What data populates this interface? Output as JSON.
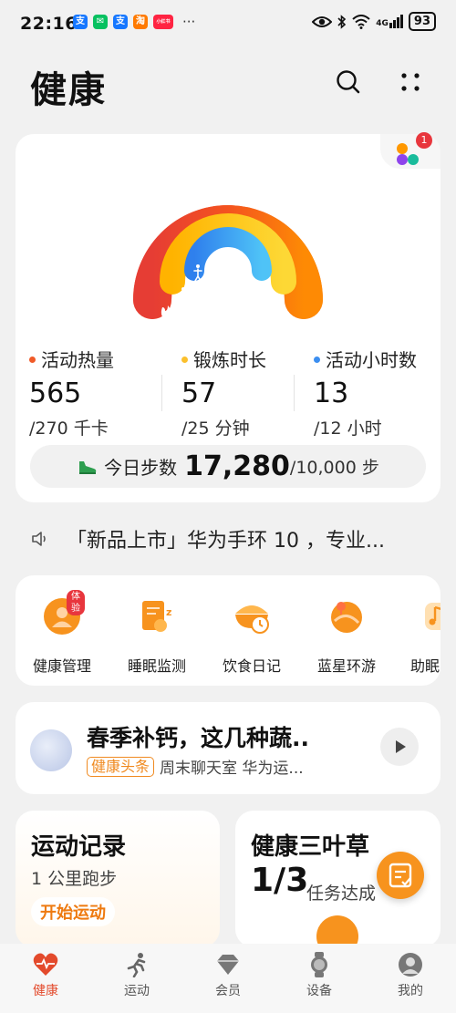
{
  "status_bar": {
    "time": "22:16",
    "app_icons": [
      {
        "name": "alipay-icon",
        "glyph": "支",
        "color": "#1677ff"
      },
      {
        "name": "wechat-icon",
        "glyph": "✉",
        "color": "#07c160"
      },
      {
        "name": "alipay-icon",
        "glyph": "支",
        "color": "#1677ff"
      },
      {
        "name": "taobao-icon",
        "glyph": "淘",
        "color": "#ff7a00"
      },
      {
        "name": "xiaohongshu-icon",
        "glyph": "小红书",
        "color": "#ff2442"
      }
    ],
    "more": "···",
    "network": "4G",
    "battery": "93"
  },
  "header": {
    "title": "健康"
  },
  "activity": {
    "notification_count": "1",
    "metrics": [
      {
        "label": "活动热量",
        "value": "565",
        "goal": "/270 千卡",
        "color": "#f05a28"
      },
      {
        "label": "锻炼时长",
        "value": "57",
        "goal": "/25 分钟",
        "color": "#fbc02d"
      },
      {
        "label": "活动小时数",
        "value": "13",
        "goal": "/12 小时",
        "color": "#3b8ef0"
      }
    ],
    "steps": {
      "label": "今日步数",
      "value": "17,280",
      "goal": "/10,000 步"
    }
  },
  "ticker": {
    "text": "「新品上市」华为手环 10 ，专业..."
  },
  "services": [
    {
      "label": "健康管理",
      "badge": "体验",
      "icon": "health-management-icon"
    },
    {
      "label": "睡眠监测",
      "icon": "sleep-monitor-icon"
    },
    {
      "label": "饮食日记",
      "icon": "diet-diary-icon"
    },
    {
      "label": "蓝星环游",
      "icon": "blue-planet-icon"
    },
    {
      "label": "助眠",
      "icon": "sleep-aid-icon"
    }
  ],
  "news": {
    "title": "春季补钙，这几种蔬..",
    "tag": "健康头条",
    "source": "周末聊天室 华为运..."
  },
  "exercise": {
    "title": "运动记录",
    "subtitle": "1 公里跑步",
    "button": "开始运动"
  },
  "clover": {
    "title": "健康三叶草",
    "progress": "1/3",
    "progress_label": "任务达成"
  },
  "tabs": [
    {
      "label": "健康",
      "icon": "heart-pulse-icon",
      "active": true
    },
    {
      "label": "运动",
      "icon": "running-icon",
      "active": false
    },
    {
      "label": "会员",
      "icon": "diamond-icon",
      "active": false
    },
    {
      "label": "设备",
      "icon": "watch-icon",
      "active": false
    },
    {
      "label": "我的",
      "icon": "profile-icon",
      "active": false
    }
  ],
  "colors": {
    "accent_orange": "#f7931e",
    "ring_red": "#f05a28",
    "ring_yellow": "#fbc02d",
    "ring_blue": "#3b8ef0",
    "tab_active": "#e34a2c"
  }
}
